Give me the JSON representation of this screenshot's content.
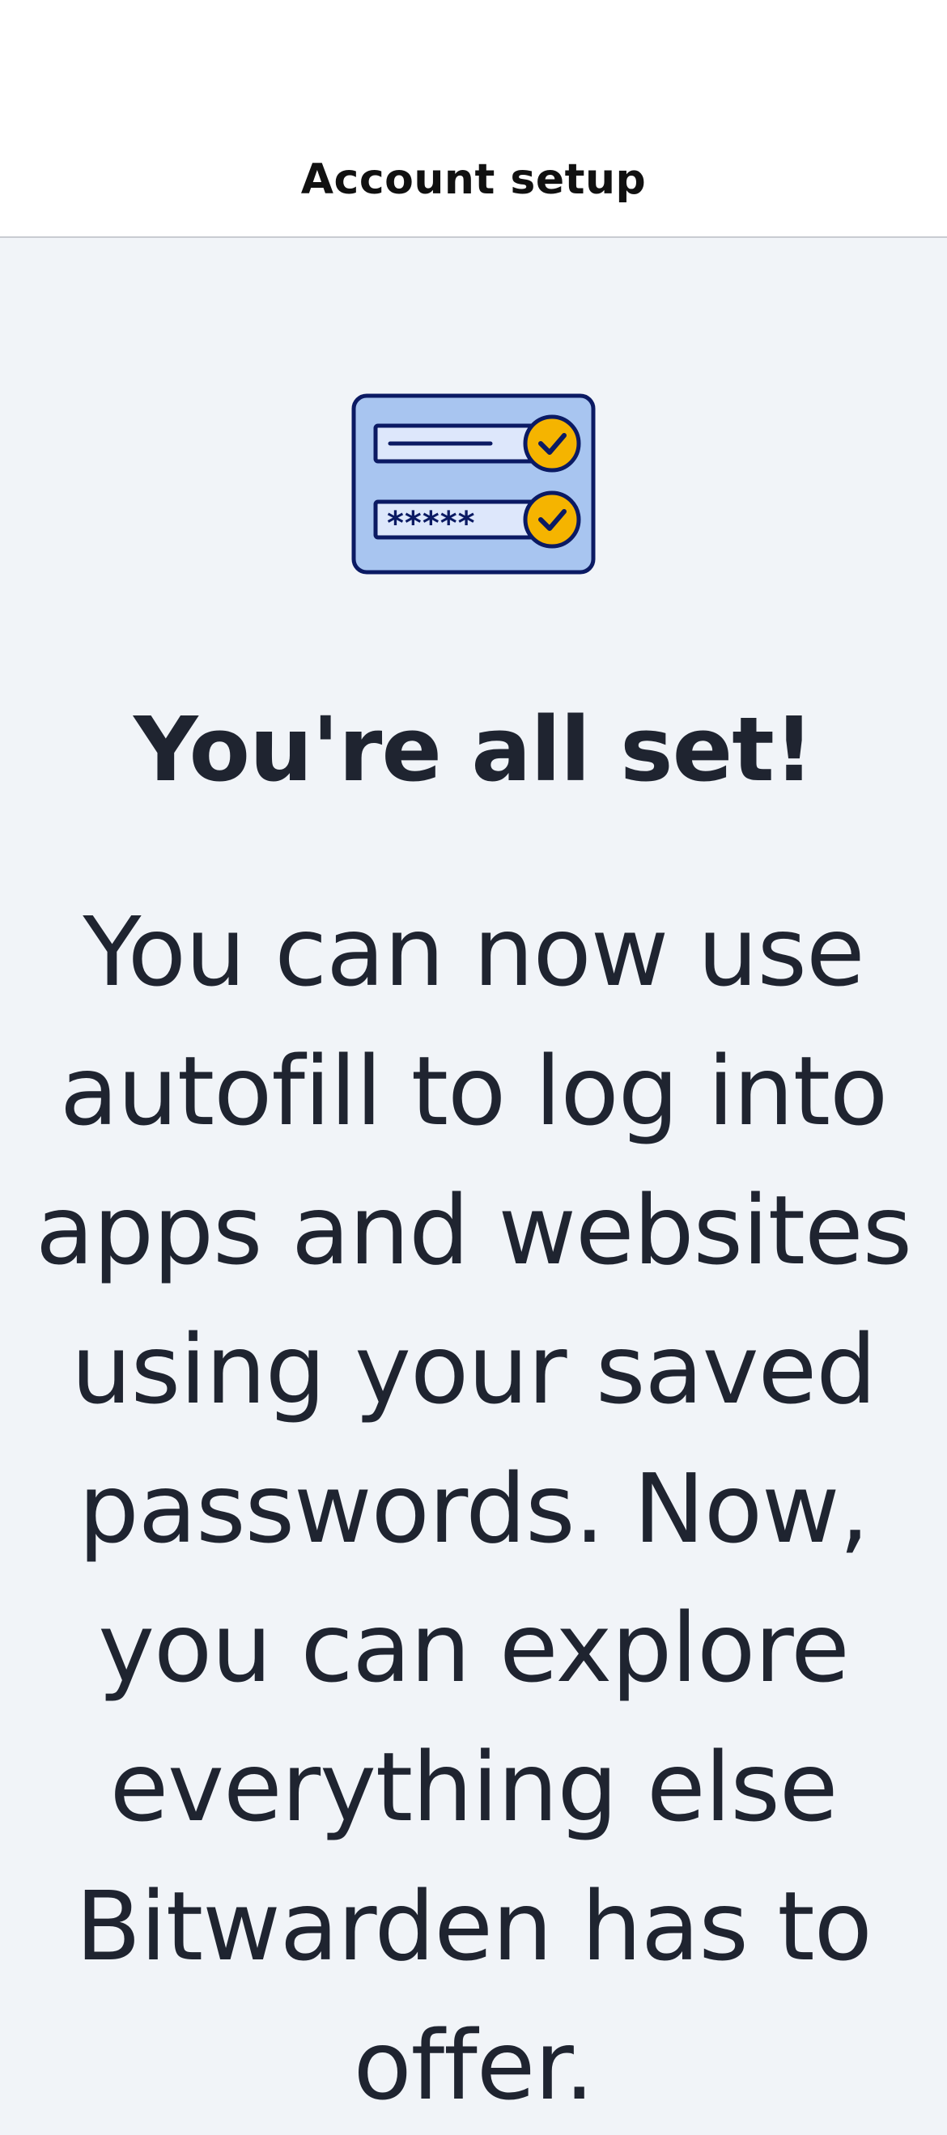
{
  "header": {
    "title": "Account setup"
  },
  "illustration": {
    "icon": "autofill-credentials-illustration",
    "password_mask": "*****",
    "colors": {
      "card": "#a8c5f0",
      "outline": "#0b1a63",
      "field": "#dde7fb",
      "check": "#f5b400"
    }
  },
  "main": {
    "headline": "You're all set!",
    "body": "You can now use autofill to log into apps and websites using your saved passwords. Now, you can explore everything else Bitwarden has to offer."
  }
}
